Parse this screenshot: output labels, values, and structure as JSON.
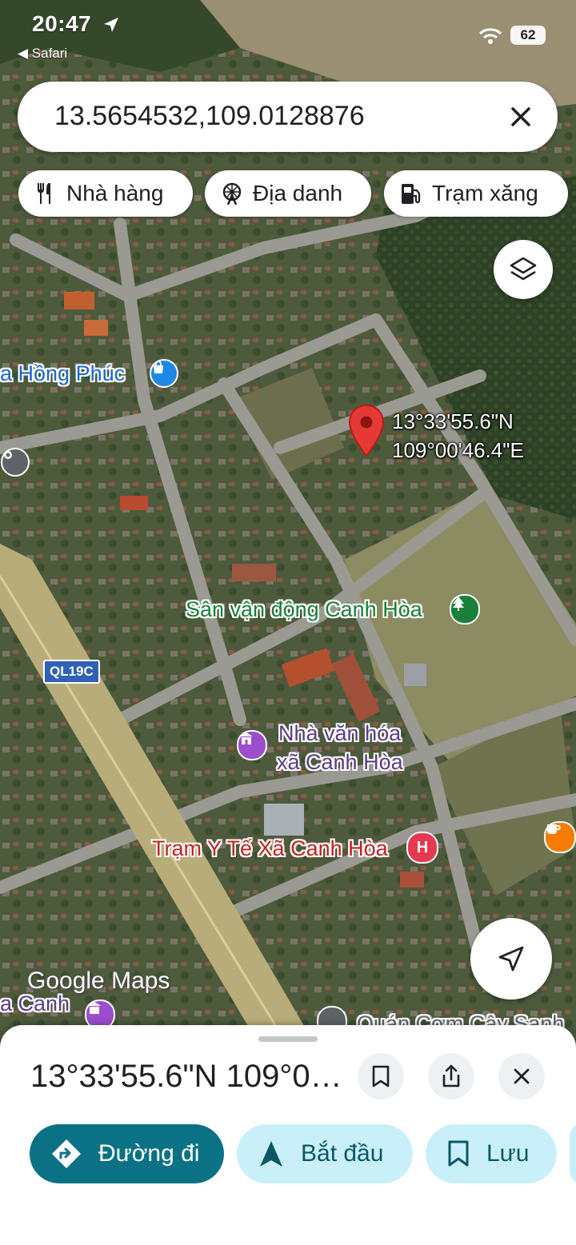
{
  "status_bar": {
    "time": "20:47",
    "back_app": "◀ Safari",
    "battery": "62"
  },
  "search": {
    "query": "13.5654532,109.0128876"
  },
  "chips": [
    {
      "label": "Nhà hàng",
      "icon": "fork-knife-icon"
    },
    {
      "label": "Địa danh",
      "icon": "ferris-wheel-icon"
    },
    {
      "label": "Trạm xăng",
      "icon": "gas-pump-icon"
    }
  ],
  "map": {
    "pin_coords_lat": "13°33'55.6\"N",
    "pin_coords_lng": "109°00'46.4\"E",
    "labels": {
      "hong_phuc": "a Hồng Phúc",
      "stadium": "Sân vận động Canh Hòa",
      "culture_line1": "Nhà văn hóa",
      "culture_line2": "xã Canh Hòa",
      "health": "Trạm Y Tế Xã Canh Hòa",
      "canh_partial": "a Canh",
      "restaurant_partial": "Quán Cơm Cây Sanh"
    },
    "road_shield": "QL19C",
    "watermark": "Google Maps"
  },
  "sheet": {
    "title": "13°33'55.6\"N 109°0…",
    "actions": {
      "directions": "Đường đi",
      "start": "Bắt đầu",
      "save": "Lưu"
    }
  },
  "colors": {
    "pin_red": "#e53935",
    "primary_action": "#0b7285",
    "secondary_action": "#c9f0f8"
  }
}
